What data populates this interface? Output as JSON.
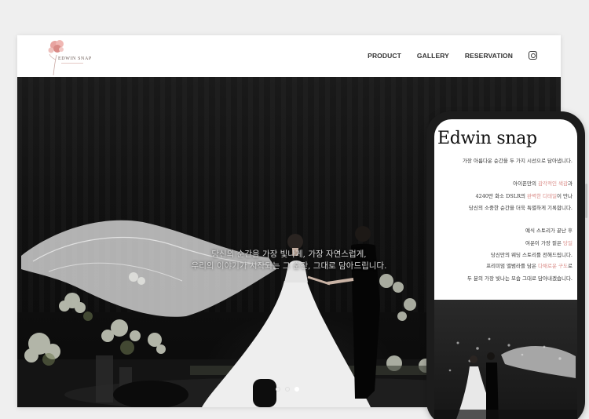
{
  "site": {
    "logo_text": "EDWIN SNAP"
  },
  "nav": {
    "items": [
      "PRODUCT",
      "GALLERY",
      "RESERVATION"
    ]
  },
  "hero": {
    "caption_line1": "당신의 순간을 가장 빛나게, 가장 자연스럽게,",
    "caption_line2": "우리의 이야기가 시작되는 그 순간, 그대로 담아드립니다.",
    "slide_count": 3,
    "active_slide": 3
  },
  "mobile": {
    "title": "Edwin snap",
    "p1": "가장 아름다운 순간을 두 가지 시선으로 담아냅니다.",
    "p2_l1_pre": "아이폰만의 ",
    "p2_l1_em": "감각적인 색감",
    "p2_l1_post": "과",
    "p2_l2_pre": "4240만 화소 DSLR의 ",
    "p2_l2_em": "완벽한 디테일",
    "p2_l2_post": "이 만나",
    "p2_l3": "당신의 소중한 순간을 더욱 특별하게 기록합니다.",
    "p3_l1": "예식 스토리가 끝난 후",
    "p3_l2_pre": "여운이 가장 짙은 ",
    "p3_l2_em": "당일",
    "p3_l3": "당신만의 웨딩 스토리를 전해드립니다.",
    "p4_l1_pre": "프리미엄 앨범라를 담은 ",
    "p4_l1_em": "다채로운 구도",
    "p4_l1_post": "로",
    "p4_l2": "두 분의 가장 빛나는 모습 그대로 담아내겠습니다."
  },
  "colors": {
    "accent_pink": "#d98a86",
    "header_bg": "#ffffff",
    "hero_bg": "#111111"
  }
}
